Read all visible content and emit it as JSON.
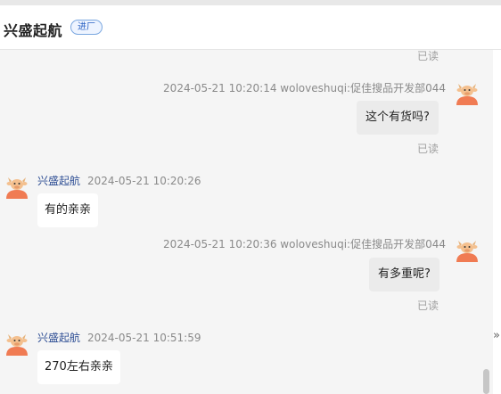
{
  "header": {
    "title": "兴盛起航",
    "badge": "进厂"
  },
  "messages": [
    {
      "read_status": "已读"
    },
    {
      "meta": "2024-05-21 10:20:14  woloveshuqi:促佳搜品开发部044",
      "text": "这个有货吗?",
      "read_status": "已读"
    },
    {
      "sender": "兴盛起航",
      "time": "2024-05-21 10:20:26",
      "text": "有的亲亲"
    },
    {
      "meta": "2024-05-21 10:20:36  woloveshuqi:促佳搜品开发部044",
      "text": "有多重呢?",
      "read_status": "已读"
    },
    {
      "sender": "兴盛起航",
      "time": "2024-05-21 10:51:59",
      "text": "270左右亲亲"
    }
  ],
  "side": {
    "arrow_glyph": "»"
  },
  "icons": {
    "avatar": "cartoon-bull-avatar-icon"
  },
  "colors": {
    "background": "#f5f5f5",
    "right_bubble": "#ebebeb",
    "left_bubble": "#ffffff",
    "sender_name": "#2f4f95",
    "badge_text": "#2b63c4"
  }
}
